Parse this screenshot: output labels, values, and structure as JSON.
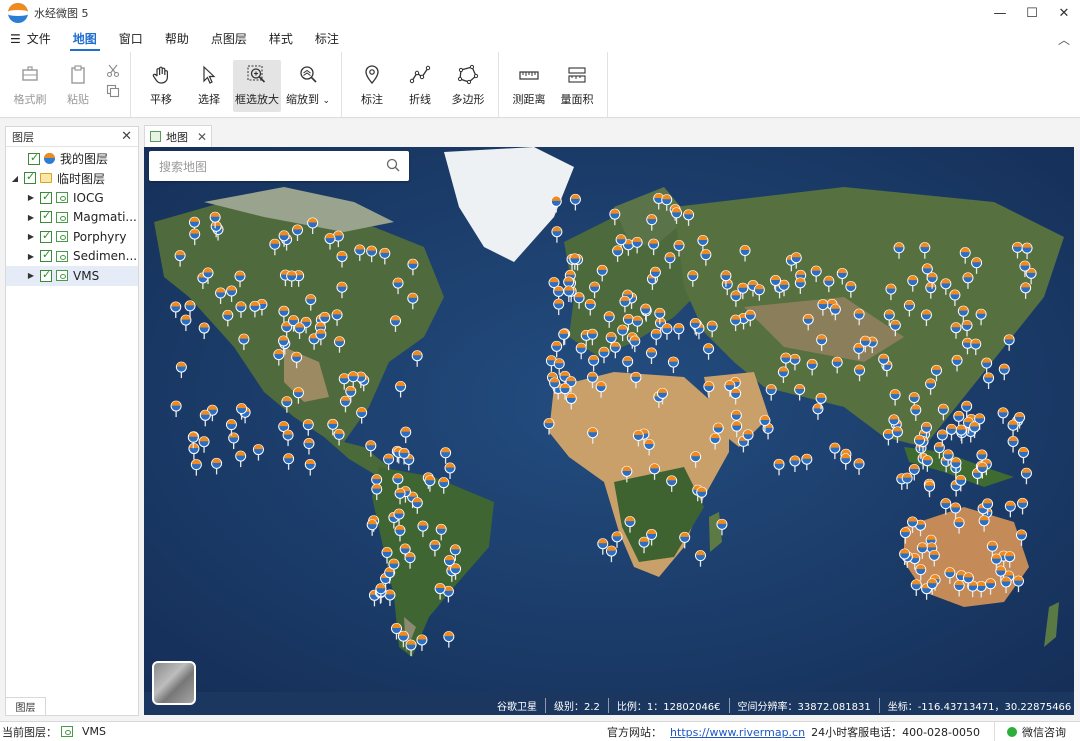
{
  "window": {
    "title": "水经微图 5",
    "controls": [
      "—",
      "☐",
      "✕"
    ]
  },
  "menu": {
    "items": [
      {
        "label": "文件",
        "active": false
      },
      {
        "label": "地图",
        "active": true
      },
      {
        "label": "窗口",
        "active": false
      },
      {
        "label": "帮助",
        "active": false
      },
      {
        "label": "点图层",
        "active": false
      },
      {
        "label": "样式",
        "active": false
      },
      {
        "label": "标注",
        "active": false
      }
    ]
  },
  "ribbon": {
    "format_brush": "格式刷",
    "paste": "粘贴",
    "pan": "平移",
    "select": "选择",
    "box_zoom": "框选放大",
    "zoom_to": "缩放到",
    "mark": "标注",
    "polyline": "折线",
    "polygon": "多边形",
    "measure_distance": "测距离",
    "measure_area": "量面积"
  },
  "layers_panel": {
    "title": "图层",
    "footer_tab": "图层",
    "tree": [
      {
        "label": "我的图层",
        "level": 0,
        "icon": "globe-icon"
      },
      {
        "label": "临时图层",
        "level": 0,
        "icon": "folder-icon"
      },
      {
        "label": "IOCG",
        "level": 1,
        "icon": "point-layer-icon"
      },
      {
        "label": "Magmati...",
        "level": 1,
        "icon": "point-layer-icon"
      },
      {
        "label": "Porphyry",
        "level": 1,
        "icon": "point-layer-icon"
      },
      {
        "label": "Sedimen...",
        "level": 1,
        "icon": "point-layer-icon"
      },
      {
        "label": "VMS",
        "level": 1,
        "icon": "point-layer-icon",
        "selected": true
      }
    ]
  },
  "map": {
    "tab_label": "地图",
    "search_placeholder": "搜索地图",
    "status": {
      "source": "谷歌卫星",
      "level": "级别：2.2",
      "scale": "比例：1：12802046€",
      "resolution": "空间分辨率：33872.081831",
      "coords": "坐标：-116.43713471，30.22875466"
    },
    "colors": {
      "ocean": "#1d3f6e",
      "land": "#4b6a3a",
      "desert": "#c9a06a",
      "ice": "#f2f4f6",
      "marker_orange": "#f08a1c",
      "marker_blue": "#2a6fc4"
    }
  },
  "statusbar": {
    "current_layer_label": "当前图层：",
    "current_layer_value": "VMS",
    "site_label": "官方网站：",
    "site_url": "https://www.rivermap.cn",
    "hotline": "24小时客服电话：400-028-0050",
    "wechat": "微信咨询"
  }
}
